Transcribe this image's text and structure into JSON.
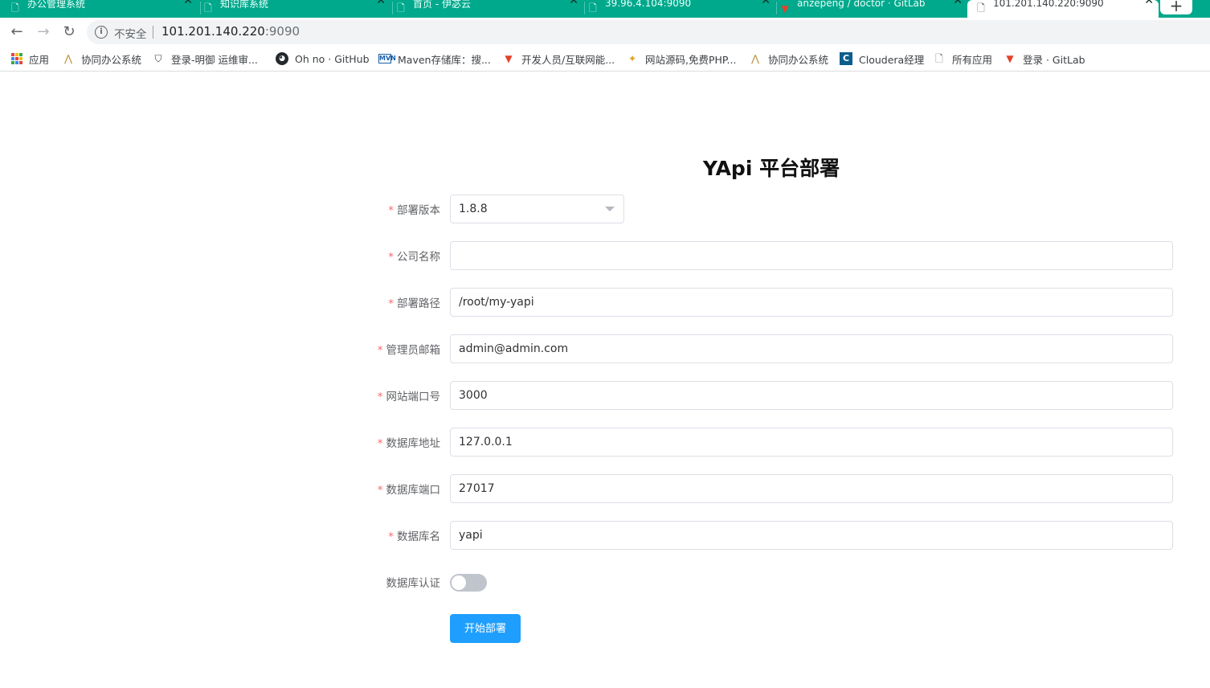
{
  "colors": {
    "tabstrip": "#00a88c",
    "primary_button": "#1e9fff",
    "required_star": "#f56c6c"
  },
  "tabs": [
    {
      "title": "办公管理系统",
      "icon": "page-icon"
    },
    {
      "title": "知识库系统",
      "icon": "page-icon"
    },
    {
      "title": "首页 - 伊苾云",
      "icon": "page-icon"
    },
    {
      "title": "39.96.4.104:9090",
      "icon": "page-icon"
    },
    {
      "title": "anzepeng / doctor · GitLab",
      "icon": "gitlab-icon"
    },
    {
      "title": "101.201.140.220:9090",
      "icon": "page-icon",
      "active": true
    }
  ],
  "tab_close_glyph": "✕",
  "new_tab_glyph": "+",
  "omnibox": {
    "security_label": "不安全",
    "url_host": "101.201.140.220",
    "url_port": ":9090"
  },
  "bookmarks": [
    {
      "label": "应用",
      "icon": "apps-grid-icon"
    },
    {
      "label": "协同办公系统",
      "icon": "bamboo-icon"
    },
    {
      "label": "登录-明御 运维审...",
      "icon": "shield-icon"
    },
    {
      "label": "Oh no · GitHub",
      "icon": "github-icon"
    },
    {
      "label": "Maven存储库：搜...",
      "icon": "mvn-icon"
    },
    {
      "label": "开发人员/互联网能...",
      "icon": "gitlab-icon"
    },
    {
      "label": "网站源码,免费PHP...",
      "icon": "bee-icon"
    },
    {
      "label": "协同办公系统",
      "icon": "bamboo-icon"
    },
    {
      "label": "Cloudera经理",
      "icon": "cloudera-icon"
    },
    {
      "label": "所有应用",
      "icon": "page-icon"
    },
    {
      "label": "登录 · GitLab",
      "icon": "gitlab-icon"
    }
  ],
  "page": {
    "title": "YApi 平台部署",
    "fields": {
      "version": {
        "label": "部署版本",
        "value": "1.8.8",
        "required": true
      },
      "company": {
        "label": "公司名称",
        "value": "",
        "required": true
      },
      "path": {
        "label": "部署路径",
        "value": "/root/my-yapi",
        "required": true
      },
      "admin_email": {
        "label": "管理员邮箱",
        "value": "admin@admin.com",
        "required": true
      },
      "site_port": {
        "label": "网站端口号",
        "value": "3000",
        "required": true
      },
      "db_host": {
        "label": "数据库地址",
        "value": "127.0.0.1",
        "required": true
      },
      "db_port": {
        "label": "数据库端口",
        "value": "27017",
        "required": true
      },
      "db_name": {
        "label": "数据库名",
        "value": "yapi",
        "required": true
      },
      "db_auth": {
        "label": "数据库认证",
        "enabled": false,
        "required": false
      }
    },
    "submit_label": "开始部署"
  }
}
